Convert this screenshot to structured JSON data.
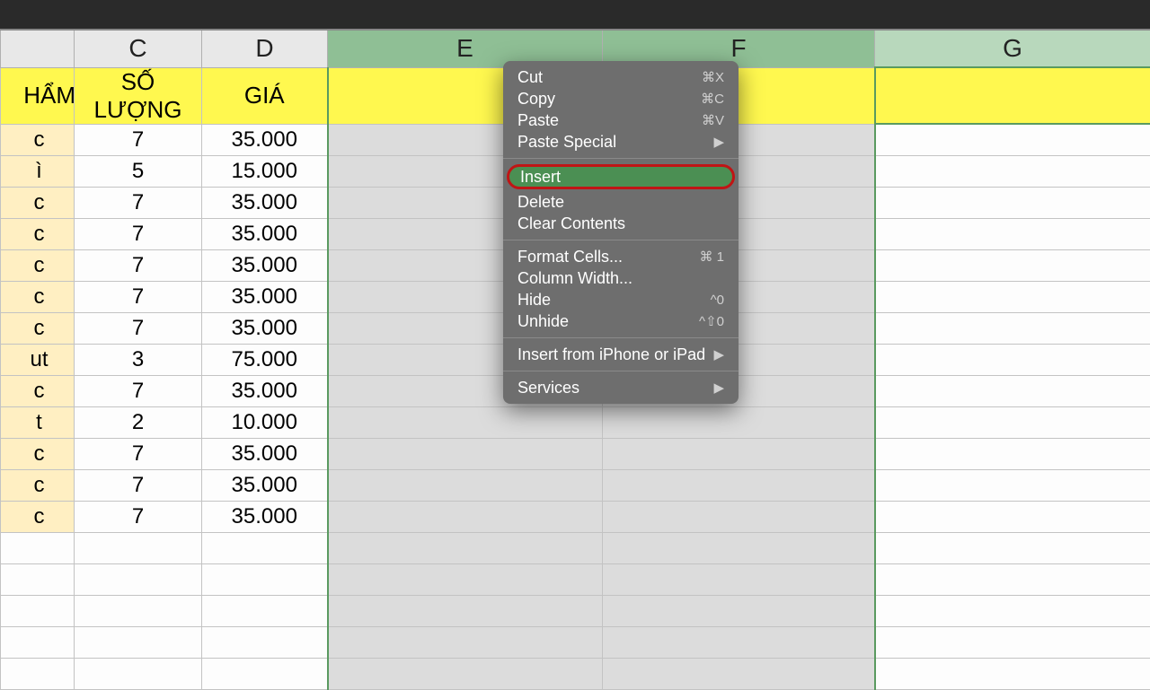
{
  "columns": {
    "b": "",
    "c": "C",
    "d": "D",
    "e": "E",
    "f": "F",
    "g": "G"
  },
  "headers": {
    "b": "HẨM",
    "c": "SỐ LƯỢNG",
    "d": "GIÁ"
  },
  "rows": [
    {
      "b": "c",
      "c": "7",
      "d": "35.000"
    },
    {
      "b": "ì",
      "c": "5",
      "d": "15.000"
    },
    {
      "b": "c",
      "c": "7",
      "d": "35.000"
    },
    {
      "b": "c",
      "c": "7",
      "d": "35.000"
    },
    {
      "b": "c",
      "c": "7",
      "d": "35.000"
    },
    {
      "b": "c",
      "c": "7",
      "d": "35.000"
    },
    {
      "b": "c",
      "c": "7",
      "d": "35.000"
    },
    {
      "b": "ut",
      "c": "3",
      "d": "75.000"
    },
    {
      "b": "c",
      "c": "7",
      "d": "35.000"
    },
    {
      "b": "t",
      "c": "2",
      "d": "10.000"
    },
    {
      "b": "c",
      "c": "7",
      "d": "35.000"
    },
    {
      "b": "c",
      "c": "7",
      "d": "35.000"
    },
    {
      "b": "c",
      "c": "7",
      "d": "35.000"
    }
  ],
  "menu": {
    "cut": {
      "label": "Cut",
      "shortcut": "⌘X"
    },
    "copy": {
      "label": "Copy",
      "shortcut": "⌘C"
    },
    "paste": {
      "label": "Paste",
      "shortcut": "⌘V"
    },
    "paste_special": {
      "label": "Paste Special",
      "sub": true
    },
    "insert": {
      "label": "Insert"
    },
    "delete": {
      "label": "Delete"
    },
    "clear": {
      "label": "Clear Contents"
    },
    "format": {
      "label": "Format Cells...",
      "shortcut": "⌘ 1"
    },
    "colwidth": {
      "label": "Column Width..."
    },
    "hide": {
      "label": "Hide",
      "shortcut": "^0"
    },
    "unhide_sc": "^⇧0",
    "unhide": {
      "label": "Unhide"
    },
    "insert_device": {
      "label": "Insert from iPhone or iPad",
      "sub": true
    },
    "services": {
      "label": "Services",
      "sub": true
    }
  }
}
